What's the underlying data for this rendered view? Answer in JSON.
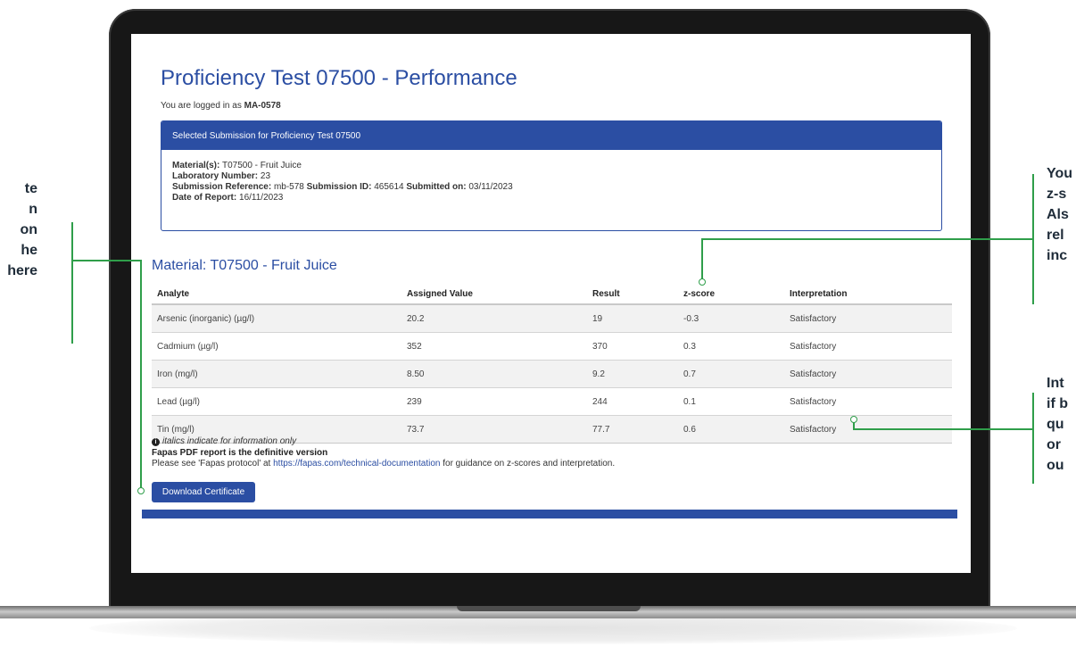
{
  "page": {
    "title": "Proficiency Test 07500 - Performance",
    "logged_in_prefix": "You are logged in as",
    "user": "MA-0578"
  },
  "submission_panel": {
    "header": "Selected Submission for Proficiency Test 07500",
    "material_label": "Material(s):",
    "material_value": "T07500 - Fruit Juice",
    "lab_label": "Laboratory Number:",
    "lab_value": "23",
    "ref_label": "Submission Reference:",
    "ref_value": "mb-578",
    "id_label": "Submission ID:",
    "id_value": "465614",
    "submitted_label": "Submitted on:",
    "submitted_value": "03/11/2023",
    "report_label": "Date of Report:",
    "report_value": "16/11/2023"
  },
  "material_section": {
    "title": "Material: T07500 - Fruit Juice",
    "columns": [
      "Analyte",
      "Assigned Value",
      "Result",
      "z-score",
      "Interpretation"
    ],
    "rows": [
      [
        "Arsenic (inorganic) (µg/l)",
        "20.2",
        "19",
        "-0.3",
        "Satisfactory"
      ],
      [
        "Cadmium (µg/l)",
        "352",
        "370",
        "0.3",
        "Satisfactory"
      ],
      [
        "Iron (mg/l)",
        "8.50",
        "9.2",
        "0.7",
        "Satisfactory"
      ],
      [
        "Lead (µg/l)",
        "239",
        "244",
        "0.1",
        "Satisfactory"
      ],
      [
        "Tin (mg/l)",
        "73.7",
        "77.7",
        "0.6",
        "Satisfactory"
      ]
    ]
  },
  "notes": {
    "italics_note": "italics indicate for information only",
    "definitive": "Fapas PDF report is the definitive version",
    "guidance_prefix": "Please see 'Fapas protocol' at ",
    "guidance_link": "https://fapas.com/technical-documentation",
    "guidance_suffix": " for guidance on z-scores and interpretation."
  },
  "download_button": "Download Certificate",
  "callouts": {
    "left": [
      "te",
      "n",
      "on",
      "he",
      "here"
    ],
    "right_top": [
      "You",
      "z-s",
      "Als",
      "rel",
      "inc"
    ],
    "right_bottom": [
      "Int",
      "if b",
      "qu",
      "or",
      "ou"
    ]
  },
  "colors": {
    "brand_blue": "#2b4ea3",
    "callout_green": "#2f9e4a",
    "laptop_frame": "#171717"
  },
  "icons": [
    "info-icon"
  ]
}
